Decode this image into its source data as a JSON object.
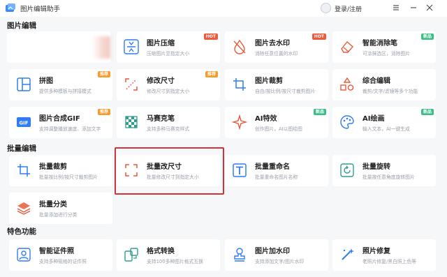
{
  "app": {
    "title": "图片编辑助手",
    "login_label": "登录/注册"
  },
  "sections": {
    "edit": "图片编辑",
    "batch": "批量编辑",
    "special": "特色功能"
  },
  "cards": {
    "compress": {
      "name": "图片压缩",
      "desc": "压缩图片至指定大小",
      "badge": "HOT"
    },
    "watermark_remove": {
      "name": "图片去水印",
      "desc": "消除任意位置的水印",
      "badge": "HOT"
    },
    "smart_erase": {
      "name": "智能消除笔",
      "desc": "可涂抹选区，消除图片",
      "badge": "新品"
    },
    "puzzle": {
      "name": "拼图",
      "desc": "提供多种模板与拼接模式",
      "badge": "推荐"
    },
    "resize": {
      "name": "修改尺寸",
      "desc": "修改尺寸到指定大小",
      "badge": "推荐"
    },
    "crop": {
      "name": "图片裁剪",
      "desc": "自由/按比例/按尺寸裁剪图片"
    },
    "combo_edit": {
      "name": "综合编辑",
      "desc": "裁剪/文字/滤镜等多个功能"
    },
    "gif": {
      "name": "图片合成GIF",
      "desc": "支持调整播放速度、添加文字",
      "badge": "推荐"
    },
    "mosaic": {
      "name": "马赛克笔",
      "desc": "支持多种马赛克样式"
    },
    "ai_effect": {
      "name": "AI特效",
      "desc": "创作图片，AI以图绘图",
      "badge": "新品"
    },
    "ai_paint": {
      "name": "AI绘画",
      "desc": "输入文本，AI一键生成",
      "badge": "新品"
    },
    "batch_crop": {
      "name": "批量裁剪",
      "desc": "批量按比例/按尺寸裁剪图片"
    },
    "batch_resize": {
      "name": "批量改尺寸",
      "desc": "批量修改尺寸到指定大小"
    },
    "batch_rename": {
      "name": "批量重命名",
      "desc": "批量重命名图片名称"
    },
    "batch_rotate": {
      "name": "批量旋转",
      "desc": "批量按任意角度旋转图片"
    },
    "batch_classify": {
      "name": "批量分类",
      "desc": "批量添加进行分类"
    },
    "id_photo": {
      "name": "智能证件照",
      "desc": "支持多种规格的证件照"
    },
    "format_convert": {
      "name": "格式转换",
      "desc": "支持100多种图片格式互换"
    },
    "add_watermark": {
      "name": "图片加水印",
      "desc": "支持添加文字/图片水印"
    },
    "photo_repair": {
      "name": "照片修复",
      "desc": "老照片修复/黑白照上色等"
    }
  },
  "colors": {
    "accent": "#2f7cf6",
    "badge_hot": "#f05a3a",
    "badge_recommend": "#f59c2d",
    "badge_new": "#3cbf86",
    "highlight": "#d0333a"
  }
}
